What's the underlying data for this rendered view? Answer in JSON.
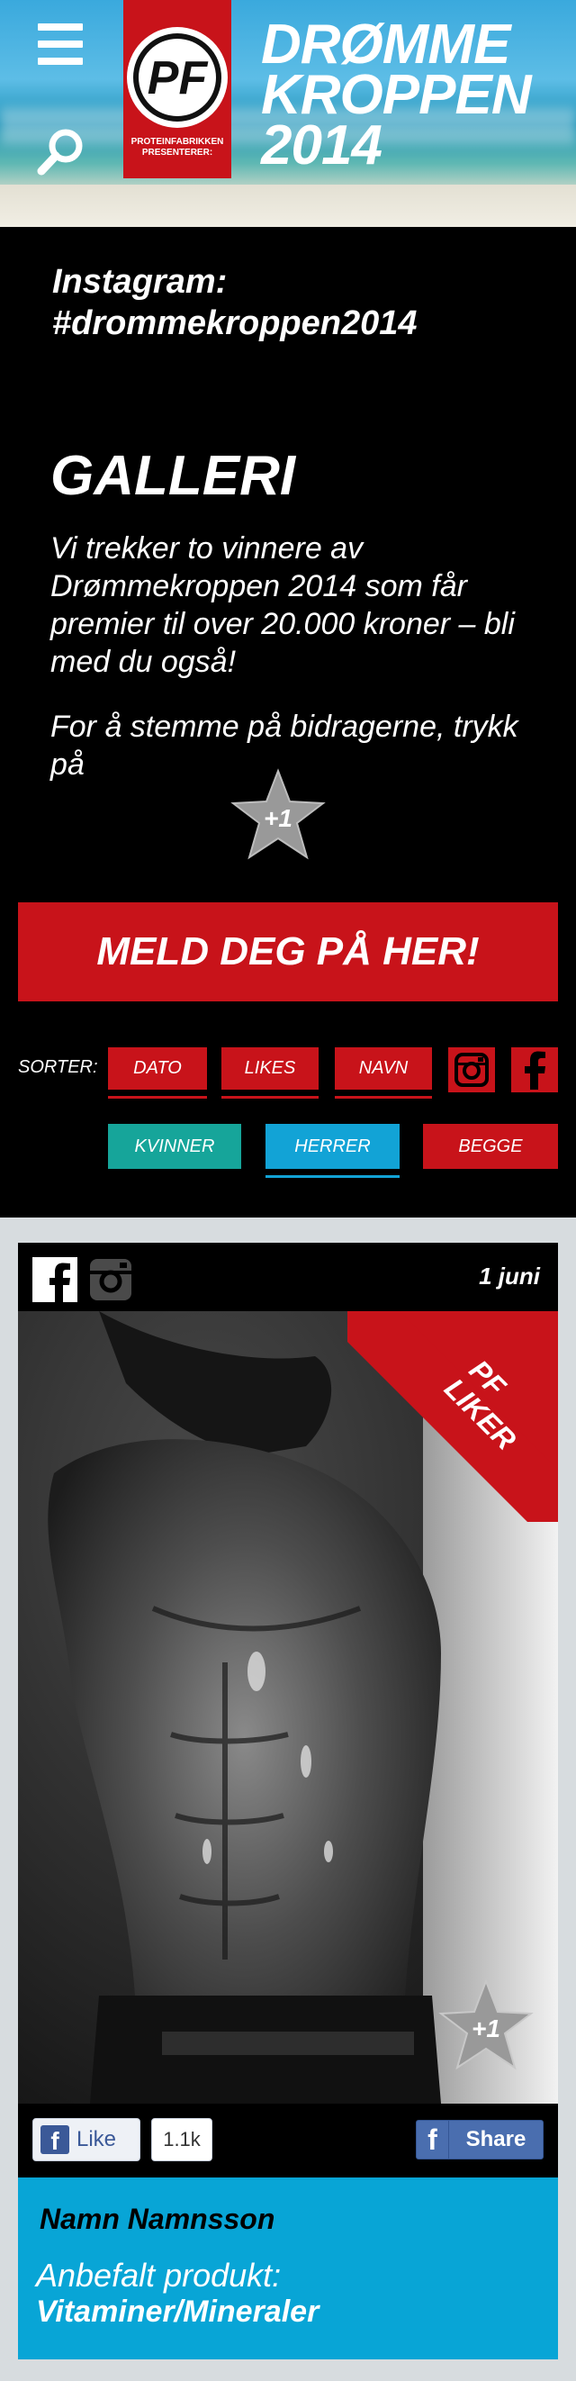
{
  "header": {
    "title_line1": "DRØMME",
    "title_line2": "KROPPEN",
    "title_line3": "2014",
    "logo_tag_line1": "PROTEINFABRIKKEN",
    "logo_tag_line2": "PRESENTERER:"
  },
  "intro": {
    "instagram_line1": "Instagram:",
    "instagram_line2": "#drommekroppen2014",
    "gallery_title": "GALLERI",
    "paragraph1": "Vi trekker to vinnere av Drømmekroppen 2014 som får premier til over 20.000 kroner – bli med du også!",
    "paragraph2": "For å stemme på bidragerne, trykk på",
    "vote_star_label": "+1"
  },
  "cta": {
    "label": "MELD DEG PÅ HER!"
  },
  "sort": {
    "label": "SORTER:",
    "buttons": [
      "DATO",
      "LIKES",
      "NAVN"
    ],
    "filters": [
      "KVINNER",
      "HERRER",
      "BEGGE"
    ]
  },
  "card": {
    "date": "1 juni",
    "ribbon_line1": "PF",
    "ribbon_line2": "LIKER",
    "vote_star_label": "+1",
    "like_label": "Like",
    "like_count": "1.1k",
    "share_label": "Share",
    "name": "Namn Namnsson",
    "recommended_label": "Anbefalt produkt:",
    "product": "Vitaminer/Mineraler"
  },
  "colors": {
    "brand_red": "#c8131a",
    "teal": "#16a59a",
    "blue": "#12a3d6",
    "card_info_blue": "#08a5d6",
    "facebook_blue": "#3b5998"
  }
}
